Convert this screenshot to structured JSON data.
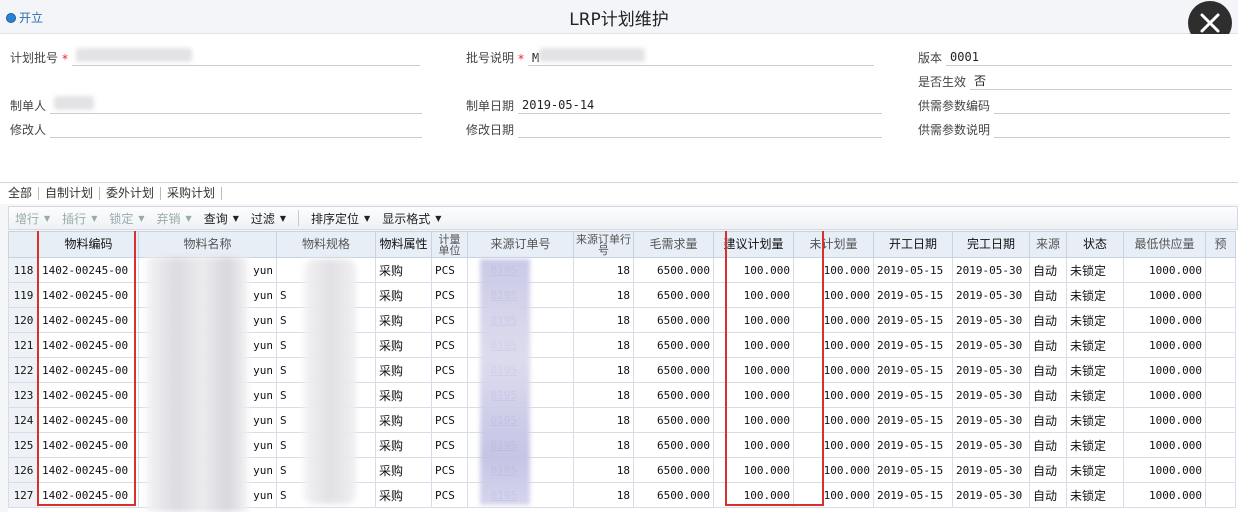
{
  "titlebar": {
    "open_label": "开立",
    "title": "LRP计划维护"
  },
  "form": {
    "batch_no_label": "计划批号",
    "batch_desc_label": "批号说明",
    "version_label": "版本",
    "version_value": "0001",
    "effective_label": "是否生效",
    "effective_value": "否",
    "creator_label": "制单人",
    "create_date_label": "制单日期",
    "create_date_value": "2019-05-14",
    "supply_code_label": "供需参数编码",
    "modifier_label": "修改人",
    "modify_date_label": "修改日期",
    "supply_desc_label": "供需参数说明",
    "required_mark": "*",
    "batch_desc_partial": "M"
  },
  "tabs": [
    "全部",
    "自制计划",
    "委外计划",
    "采购计划"
  ],
  "toolbar": {
    "add_row": "增行",
    "insert_row": "插行",
    "lock": "锁定",
    "discard": "弃销",
    "query": "查询",
    "filter": "过滤",
    "sort_locate": "排序定位",
    "display_format": "显示格式"
  },
  "grid": {
    "headers": {
      "material_code": "物料编码",
      "material_name": "物料名称",
      "material_spec": "物料规格",
      "material_attr": "物料属性",
      "unit": "计量单位",
      "source_order": "来源订单号",
      "source_line": "来源订单行号",
      "gross_demand": "毛需求量",
      "suggested_qty": "建议计划量",
      "unplanned_qty": "未计划量",
      "start_date": "开工日期",
      "finish_date": "完工日期",
      "source": "来源",
      "status": "状态",
      "min_supply": "最低供应量",
      "pre": "预"
    },
    "rows": [
      {
        "no": "118",
        "code": "1402-00245-00",
        "name_tail": "yun",
        "spec_head": "",
        "attr": "采购",
        "unit": "PCS",
        "order_tail": "0195",
        "line": "18",
        "gross": "6500.000",
        "suggested": "100.000",
        "unplanned": "100.000",
        "start": "2019-05-15",
        "finish": "2019-05-30",
        "source": "自动",
        "status": "未锁定",
        "min": "1000.000"
      },
      {
        "no": "119",
        "code": "1402-00245-00",
        "name_tail": "yun",
        "spec_head": "S",
        "attr": "采购",
        "unit": "PCS",
        "order_tail": "0195",
        "line": "18",
        "gross": "6500.000",
        "suggested": "100.000",
        "unplanned": "100.000",
        "start": "2019-05-15",
        "finish": "2019-05-30",
        "source": "自动",
        "status": "未锁定",
        "min": "1000.000"
      },
      {
        "no": "120",
        "code": "1402-00245-00",
        "name_tail": "yun",
        "spec_head": "S",
        "attr": "采购",
        "unit": "PCS",
        "order_tail": "0195",
        "line": "18",
        "gross": "6500.000",
        "suggested": "100.000",
        "unplanned": "100.000",
        "start": "2019-05-15",
        "finish": "2019-05-30",
        "source": "自动",
        "status": "未锁定",
        "min": "1000.000"
      },
      {
        "no": "121",
        "code": "1402-00245-00",
        "name_tail": "yun",
        "spec_head": "S",
        "attr": "采购",
        "unit": "PCS",
        "order_tail": "0195",
        "line": "18",
        "gross": "6500.000",
        "suggested": "100.000",
        "unplanned": "100.000",
        "start": "2019-05-15",
        "finish": "2019-05-30",
        "source": "自动",
        "status": "未锁定",
        "min": "1000.000"
      },
      {
        "no": "122",
        "code": "1402-00245-00",
        "name_tail": "yun",
        "spec_head": "S",
        "attr": "采购",
        "unit": "PCS",
        "order_tail": "0195",
        "line": "18",
        "gross": "6500.000",
        "suggested": "100.000",
        "unplanned": "100.000",
        "start": "2019-05-15",
        "finish": "2019-05-30",
        "source": "自动",
        "status": "未锁定",
        "min": "1000.000"
      },
      {
        "no": "123",
        "code": "1402-00245-00",
        "name_tail": "yun",
        "spec_head": "S",
        "attr": "采购",
        "unit": "PCS",
        "order_tail": "0195",
        "line": "18",
        "gross": "6500.000",
        "suggested": "100.000",
        "unplanned": "100.000",
        "start": "2019-05-15",
        "finish": "2019-05-30",
        "source": "自动",
        "status": "未锁定",
        "min": "1000.000"
      },
      {
        "no": "124",
        "code": "1402-00245-00",
        "name_tail": "yun",
        "spec_head": "S",
        "attr": "采购",
        "unit": "PCS",
        "order_tail": "0195",
        "line": "18",
        "gross": "6500.000",
        "suggested": "100.000",
        "unplanned": "100.000",
        "start": "2019-05-15",
        "finish": "2019-05-30",
        "source": "自动",
        "status": "未锁定",
        "min": "1000.000"
      },
      {
        "no": "125",
        "code": "1402-00245-00",
        "name_tail": "yun",
        "spec_head": "S",
        "attr": "采购",
        "unit": "PCS",
        "order_tail": "0195",
        "line": "18",
        "gross": "6500.000",
        "suggested": "100.000",
        "unplanned": "100.000",
        "start": "2019-05-15",
        "finish": "2019-05-30",
        "source": "自动",
        "status": "未锁定",
        "min": "1000.000"
      },
      {
        "no": "126",
        "code": "1402-00245-00",
        "name_tail": "yun",
        "spec_head": "S",
        "attr": "采购",
        "unit": "PCS",
        "order_tail": "0195",
        "line": "18",
        "gross": "6500.000",
        "suggested": "100.000",
        "unplanned": "100.000",
        "start": "2019-05-15",
        "finish": "2019-05-30",
        "source": "自动",
        "status": "未锁定",
        "min": "1000.000"
      },
      {
        "no": "127",
        "code": "1402-00245-00",
        "name_tail": "yun",
        "spec_head": "S",
        "attr": "采购",
        "unit": "PCS",
        "order_tail": "0195",
        "line": "18",
        "gross": "6500.000",
        "suggested": "100.000",
        "unplanned": "100.000",
        "start": "2019-05-15",
        "finish": "2019-05-30",
        "source": "自动",
        "status": "未锁定",
        "min": "1000.000"
      }
    ]
  },
  "colors": {
    "highlight": "#d9302c",
    "link": "#1a3fa8",
    "header_bg": "#e8eef6"
  }
}
